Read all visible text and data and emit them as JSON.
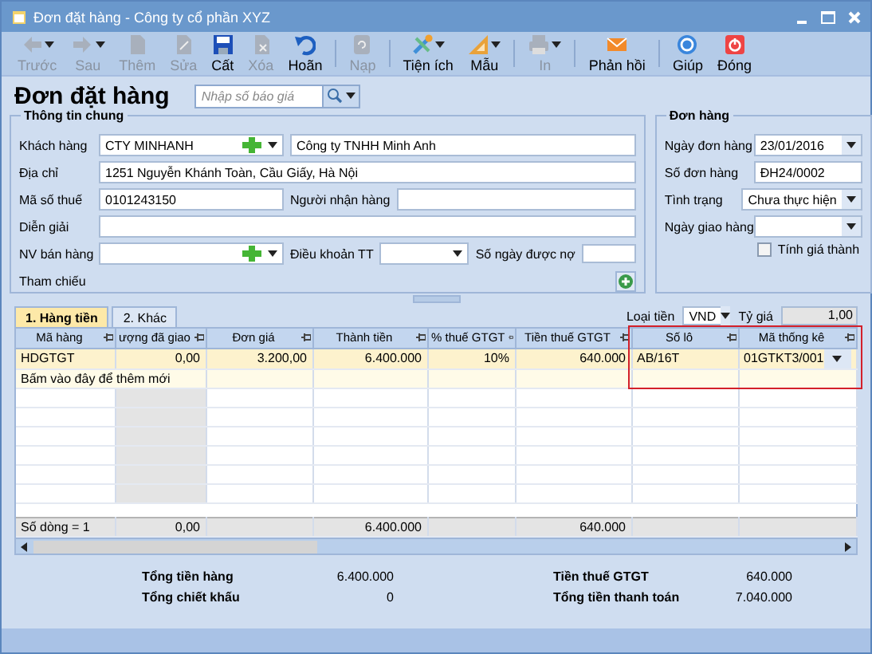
{
  "window": {
    "title": "Đơn đặt hàng - Công ty cổ phần XYZ"
  },
  "toolbar": [
    {
      "label": "Trước",
      "disabled": true,
      "dropdown": true,
      "separator_before": false
    },
    {
      "label": "Sau",
      "disabled": true,
      "dropdown": true,
      "separator_before": false
    },
    {
      "label": "Thêm",
      "disabled": true,
      "dropdown": false,
      "separator_before": false
    },
    {
      "label": "Sửa",
      "disabled": true,
      "dropdown": false,
      "separator_before": false
    },
    {
      "label": "Cất",
      "disabled": false,
      "dropdown": false,
      "separator_before": false
    },
    {
      "label": "Xóa",
      "disabled": true,
      "dropdown": false,
      "separator_before": false
    },
    {
      "label": "Hoãn",
      "disabled": false,
      "dropdown": false,
      "separator_before": false
    },
    {
      "label": "Nạp",
      "disabled": true,
      "dropdown": false,
      "separator_before": true
    },
    {
      "label": "Tiện ích",
      "disabled": false,
      "dropdown": true,
      "separator_before": true
    },
    {
      "label": "Mẫu",
      "disabled": false,
      "dropdown": true,
      "separator_before": false
    },
    {
      "label": "In",
      "disabled": true,
      "dropdown": true,
      "separator_before": true
    },
    {
      "label": "Phản hồi",
      "disabled": false,
      "dropdown": false,
      "separator_before": true
    },
    {
      "label": "Giúp",
      "disabled": false,
      "dropdown": false,
      "separator_before": true
    },
    {
      "label": "Đóng",
      "disabled": false,
      "dropdown": false,
      "separator_before": false
    }
  ],
  "heading": "Đơn đặt hàng",
  "search": {
    "placeholder": "Nhập số báo giá"
  },
  "general": {
    "title": "Thông tin chung",
    "customer": {
      "label": "Khách hàng",
      "code": "CTY MINHANH",
      "name": "Công ty TNHH Minh Anh"
    },
    "address": {
      "label": "Địa chỉ",
      "value": "1251 Nguyễn Khánh Toàn, Cầu Giấy, Hà Nội"
    },
    "tax_code": {
      "label": "Mã số thuế",
      "value": "0101243150"
    },
    "receiver": {
      "label": "Người nhận hàng"
    },
    "description": {
      "label": "Diễn giải"
    },
    "salesperson": {
      "label": "NV bán hàng"
    },
    "payment_terms": {
      "label": "Điều khoản TT"
    },
    "debt_days": {
      "label": "Số ngày được nợ"
    },
    "reference": {
      "label": "Tham chiếu"
    }
  },
  "order": {
    "title": "Đơn hàng",
    "fields": [
      {
        "label": "Ngày đơn hàng",
        "value": "23/01/2016",
        "kind": "dropdown"
      },
      {
        "label": "Số đơn hàng",
        "value": "ĐH24/0002",
        "kind": "text"
      },
      {
        "label": "Tình trạng",
        "value": "Chưa thực hiện",
        "kind": "dropdown"
      },
      {
        "label": "Ngày giao hàng",
        "kind": "dropdown"
      }
    ],
    "costing": {
      "label": "Tính giá thành",
      "checked": false
    }
  },
  "currency": {
    "label": "Loại tiền",
    "value": "VND"
  },
  "rate": {
    "label": "Tỷ giá",
    "value": "1,00"
  },
  "tabs": [
    {
      "label": "1. Hàng tiền",
      "selected": true
    },
    {
      "label": "2. Khác",
      "selected": false
    }
  ],
  "grid": {
    "columns": [
      {
        "label": "Mã hàng",
        "kind": "text",
        "highlighted": false
      },
      {
        "label": "ượng đã giao",
        "kind": "number",
        "highlighted": false
      },
      {
        "label": "Đơn giá",
        "kind": "number",
        "highlighted": false
      },
      {
        "label": "Thành tiền",
        "kind": "number",
        "highlighted": false
      },
      {
        "label": "% thuế GTGT",
        "kind": "number",
        "highlighted": false
      },
      {
        "label": "Tiền thuế GTGT",
        "kind": "number",
        "highlighted": false
      },
      {
        "label": "Số lô",
        "kind": "text",
        "highlighted": true
      },
      {
        "label": "Mã thống kê",
        "kind": "text",
        "highlighted": true
      }
    ],
    "rows": [
      {
        "cells": [
          "HDGTGT",
          "0,00",
          "3.200,00",
          "6.400.000",
          "10%",
          "640.000",
          "AB/16T",
          "01GTKT3/001"
        ]
      }
    ],
    "new_row_hint": "Bấm vào đây để thêm mới",
    "summary": [
      {
        "kind": "count",
        "text": "Số dòng = 1"
      },
      {
        "kind": "sum",
        "text": "0,00"
      },
      {
        "kind": "blank"
      },
      {
        "kind": "sum",
        "text": "6.400.000"
      },
      {
        "kind": "blank"
      },
      {
        "kind": "sum",
        "text": "640.000"
      },
      {
        "kind": "blank"
      },
      {
        "kind": "blank"
      }
    ]
  },
  "totals": [
    {
      "label": "Tổng tiền hàng",
      "value": "6.400.000"
    },
    {
      "label": "Tổng chiết khấu",
      "value": "0"
    },
    {
      "label": "Tiền thuế GTGT",
      "value": "640.000"
    },
    {
      "label": "Tổng tiền thanh toán",
      "value": "7.040.000"
    }
  ]
}
